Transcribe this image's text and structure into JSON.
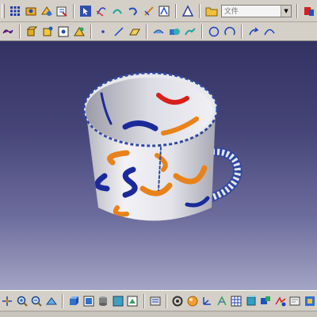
{
  "top_toolbar": {
    "layer_select": {
      "value": "文件"
    },
    "icons": [
      "grid-icon",
      "snap-icon",
      "sketch-icon",
      "open-file-icon",
      "cursor-icon",
      "connect-icon",
      "undo-arc-icon",
      "redo-arc-icon",
      "measure-icon",
      "zoom-fit-icon",
      "delta-icon",
      "folder-icon",
      "properties-icon"
    ]
  },
  "second_toolbar": {
    "icons": [
      "material-icon",
      "extrude-icon",
      "rotate-icon",
      "point-icon",
      "draft-icon",
      "dot-icon",
      "line-icon",
      "plane-icon",
      "project-icon",
      "boolean-icon",
      "join-icon",
      "circle-icon",
      "arc-icon",
      "redo-icon",
      "curve-icon"
    ]
  },
  "bottom_toolbar": {
    "icons": [
      "pan-icon",
      "zoom-in-icon",
      "zoom-out-icon",
      "normal-view-icon",
      "iso-view-icon",
      "front-view-icon",
      "multi-view-icon",
      "shading-icon",
      "hide-show-icon",
      "swap-icon",
      "fly-icon",
      "render-icon",
      "axis-icon",
      "compass-icon",
      "table-icon",
      "measure-icon",
      "analysis-icon",
      "lights-icon",
      "camera-icon",
      "tools-icon"
    ]
  },
  "model": {
    "object": "mug",
    "colors": {
      "body": "#e8e8ec",
      "blue": "#1a2a9a",
      "orange": "#e8821a",
      "red": "#d8201a"
    }
  }
}
